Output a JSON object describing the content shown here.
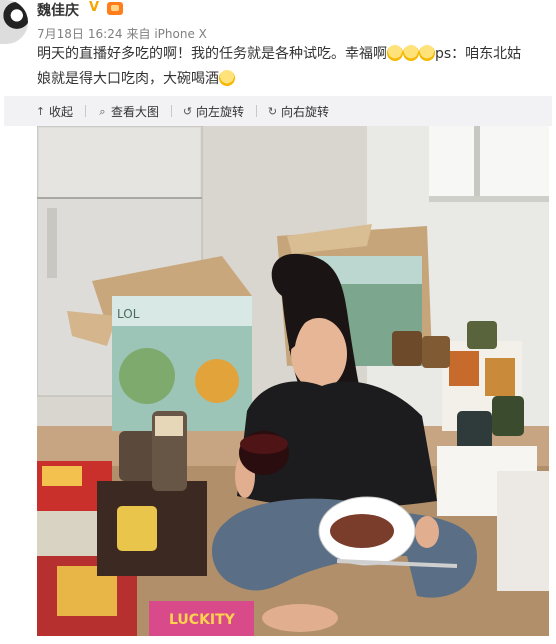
{
  "user": {
    "name": "魏佳庆",
    "verified_badge": "V"
  },
  "meta": {
    "date": "7月18日",
    "time": "16:24",
    "source": "来自 iPhone X"
  },
  "post": {
    "text_part1": "明天的直播好多吃的啊！我的任务就是各种试吃。幸福啊",
    "text_part2": "ps：咱东北姑",
    "text_line2": "娘就是得大口吃肉，大碗喝酒"
  },
  "toolbar": {
    "collapse_label": "收起",
    "view_large_label": "查看大图",
    "rotate_left_label": "向左旋转",
    "rotate_right_label": "向右旋转"
  },
  "photo": {
    "box_text": "LOL",
    "sign_text": "LUCKITY"
  },
  "colors": {
    "toolbar_bg": "#f2f2f5",
    "meta_text": "#808080",
    "verified": "#f7a500"
  }
}
